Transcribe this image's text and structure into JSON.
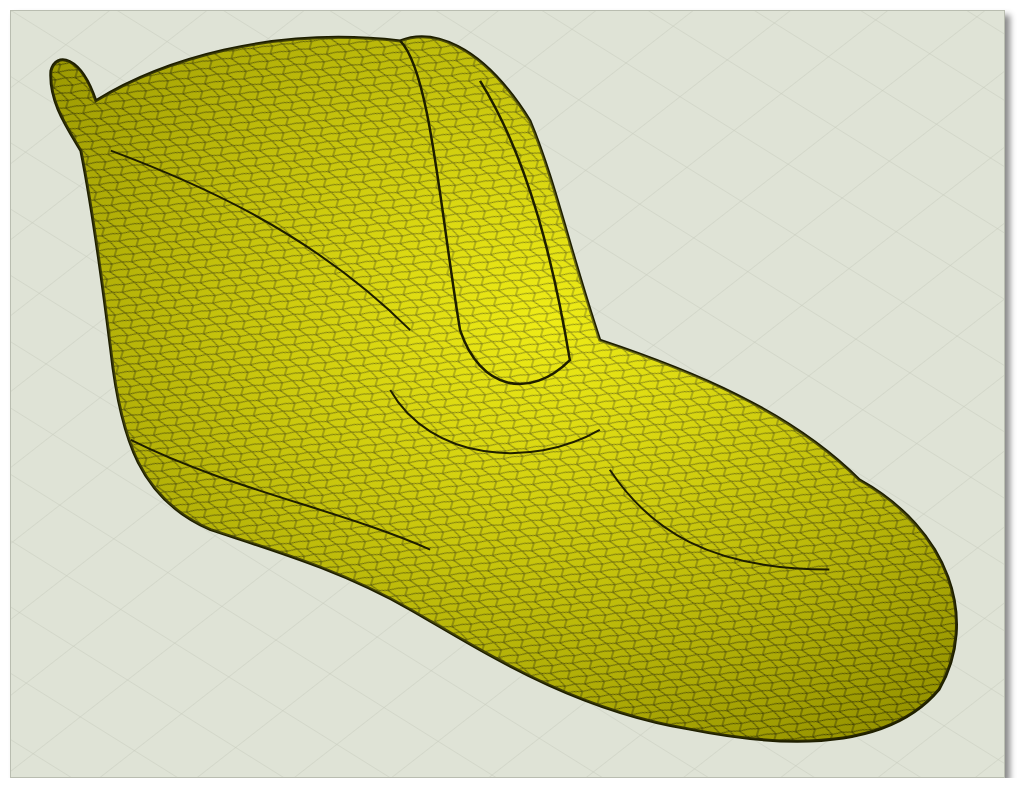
{
  "viewport": {
    "show_grid": true
  }
}
